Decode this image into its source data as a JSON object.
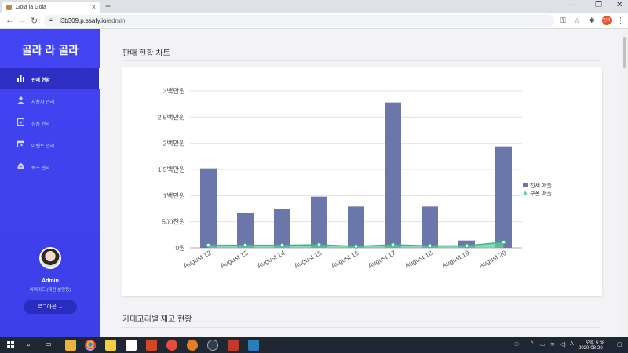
{
  "browser": {
    "tab_title": "Gola la Gola",
    "tab_close": "×",
    "new_tab": "+",
    "url_host": "i3b309.p.ssafy.io",
    "url_path": "/admin",
    "profile_label": "민저"
  },
  "sidebar": {
    "brand": "골라 라 골라",
    "items": [
      {
        "label": "판매 현황",
        "icon": "bar-chart-icon",
        "active": true
      },
      {
        "label": "사용자 관리",
        "icon": "user-icon",
        "active": false
      },
      {
        "label": "상품 관리",
        "icon": "box-icon",
        "active": false
      },
      {
        "label": "이벤트 관리",
        "icon": "calendar-icon",
        "active": false
      },
      {
        "label": "쿼즈 관리",
        "icon": "envelope-icon",
        "active": false
      }
    ],
    "user_name": "Admin",
    "user_role": "싸피이드 (대전 분망등)",
    "logout_label": "로그아웃 →"
  },
  "main": {
    "title": "판매 현황 차트",
    "section2_title": "카테고리별 재고 현황"
  },
  "chart_data": {
    "type": "bar",
    "categories": [
      "August 12",
      "August 13",
      "August 14",
      "August 15",
      "August 16",
      "August 17",
      "August 18",
      "August 19",
      "August 20"
    ],
    "series": [
      {
        "name": "전체 매출",
        "type": "bar",
        "color": "#6b76ab",
        "values": [
          1520000,
          660000,
          740000,
          980000,
          790000,
          2780000,
          790000,
          140000,
          1940000
        ]
      },
      {
        "name": "쿠폰 매출",
        "type": "area",
        "color": "#5ecda0",
        "values": [
          50000,
          50000,
          50000,
          60000,
          30000,
          60000,
          40000,
          40000,
          110000
        ]
      }
    ],
    "y_ticks": [
      "0원",
      "500천원",
      "1백만원",
      "1.5백만원",
      "2백만원",
      "2.5백만원",
      "3백만원"
    ],
    "ylim": [
      0,
      3000000
    ],
    "grid": true,
    "legend_position": "right"
  },
  "taskbar": {
    "time": "오후 5:38",
    "date": "2020-08-20"
  }
}
